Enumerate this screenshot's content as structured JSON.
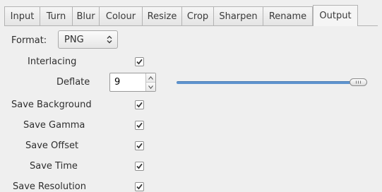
{
  "tabs": [
    {
      "label": "Input",
      "active": false
    },
    {
      "label": "Turn",
      "active": false
    },
    {
      "label": "Blur",
      "active": false
    },
    {
      "label": "Colour",
      "active": false
    },
    {
      "label": "Resize",
      "active": false
    },
    {
      "label": "Crop",
      "active": false
    },
    {
      "label": "Sharpen",
      "active": false
    },
    {
      "label": "Rename",
      "active": false
    },
    {
      "label": "Output",
      "active": true
    }
  ],
  "output": {
    "format_label": "Format:",
    "format_value": "PNG",
    "interlacing_label": "Interlacing",
    "interlacing_checked": true,
    "deflate_label": "Deflate",
    "deflate_value": "9",
    "deflate_level": 1.0,
    "save_background_label": "Save Background",
    "save_background_checked": true,
    "save_gamma_label": "Save Gamma",
    "save_gamma_checked": true,
    "save_offset_label": "Save Offset",
    "save_offset_checked": true,
    "save_time_label": "Save Time",
    "save_time_checked": true,
    "save_resolution_label": "Save Resolution",
    "save_resolution_checked": true
  },
  "icons": {
    "combo_arrow": "updown-arrows-icon",
    "checkbox_mark": "checkmark-icon",
    "spin_up": "triangle-up-icon",
    "spin_down": "triangle-down-icon",
    "slider_grip": "grip-icon"
  },
  "colors": {
    "slider_fill": "#5f94cf",
    "background": "#efefef"
  }
}
